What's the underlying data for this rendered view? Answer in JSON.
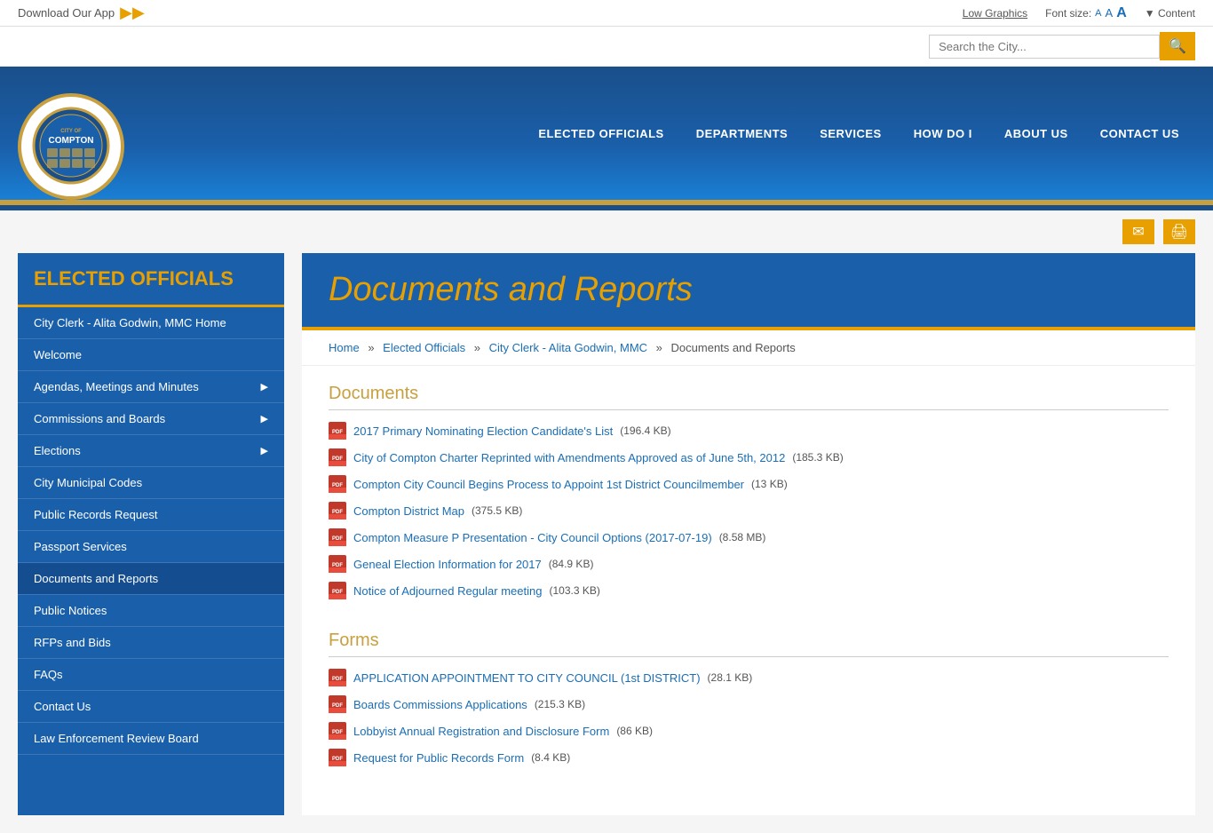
{
  "topbar": {
    "download_label": "Download Our App",
    "low_graphics": "Low Graphics",
    "font_size_label": "Font size:",
    "font_a_small": "A",
    "font_a_med": "A",
    "font_a_large": "A",
    "content_toggle": "▼ Content",
    "search_placeholder": "Search the City..."
  },
  "header": {
    "logo_city_of": "CITY OF",
    "logo_compton": "COMPTON"
  },
  "nav": {
    "items": [
      {
        "label": "ELECTED OFFICIALS",
        "id": "elected-officials"
      },
      {
        "label": "DEPARTMENTS",
        "id": "departments"
      },
      {
        "label": "SERVICES",
        "id": "services"
      },
      {
        "label": "HOW DO I",
        "id": "how-do-i"
      },
      {
        "label": "ABOUT US",
        "id": "about-us"
      },
      {
        "label": "CONTACT US",
        "id": "contact-us"
      }
    ]
  },
  "sidebar": {
    "title": "ELECTED OFFICIALS",
    "menu": [
      {
        "label": "City Clerk - Alita Godwin, MMC Home",
        "has_arrow": false
      },
      {
        "label": "Welcome",
        "has_arrow": false
      },
      {
        "label": "Agendas, Meetings and Minutes",
        "has_arrow": true
      },
      {
        "label": "Commissions and Boards",
        "has_arrow": true
      },
      {
        "label": "Elections",
        "has_arrow": true
      },
      {
        "label": "City Municipal Codes",
        "has_arrow": false
      },
      {
        "label": "Public Records Request",
        "has_arrow": false
      },
      {
        "label": "Passport Services",
        "has_arrow": false
      },
      {
        "label": "Documents and Reports",
        "has_arrow": false,
        "active": true
      },
      {
        "label": "Public Notices",
        "has_arrow": false
      },
      {
        "label": "RFPs and Bids",
        "has_arrow": false
      },
      {
        "label": "FAQs",
        "has_arrow": false
      },
      {
        "label": "Contact Us",
        "has_arrow": false
      },
      {
        "label": "Law Enforcement Review Board",
        "has_arrow": false
      }
    ]
  },
  "page": {
    "title": "Documents and Reports",
    "breadcrumb": {
      "home": "Home",
      "level1": "Elected Officials",
      "level2": "City Clerk - Alita Godwin, MMC",
      "current": "Documents and Reports"
    }
  },
  "content": {
    "sections": [
      {
        "title": "Documents",
        "items": [
          {
            "name": "2017 Primary Nominating Election Candidate's List",
            "size": "(196.4 KB)"
          },
          {
            "name": "City of Compton Charter Reprinted with Amendments Approved as of June 5th, 2012",
            "size": "(185.3 KB)"
          },
          {
            "name": "Compton City Council Begins Process to Appoint 1st District Councilmember",
            "size": "(13 KB)"
          },
          {
            "name": "Compton District Map",
            "size": "(375.5 KB)"
          },
          {
            "name": "Compton Measure P Presentation - City Council Options (2017-07-19)",
            "size": "(8.58 MB)"
          },
          {
            "name": "Geneal Election Information for 2017",
            "size": "(84.9 KB)"
          },
          {
            "name": "Notice of Adjourned Regular meeting",
            "size": "(103.3 KB)"
          }
        ]
      },
      {
        "title": "Forms",
        "items": [
          {
            "name": "APPLICATION APPOINTMENT TO CITY COUNCIL (1st DISTRICT)",
            "size": "(28.1 KB)"
          },
          {
            "name": "Boards Commissions Applications",
            "size": "(215.3 KB)"
          },
          {
            "name": "Lobbyist Annual Registration and Disclosure Form",
            "size": "(86 KB)"
          },
          {
            "name": "Request for Public Records Form",
            "size": "(8.4 KB)"
          }
        ]
      }
    ]
  },
  "icons": {
    "email": "✉",
    "print": "🖨",
    "pdf": "PDF",
    "arrow_right": "▶",
    "search": "🔍",
    "app_arrow": "▶▶"
  }
}
